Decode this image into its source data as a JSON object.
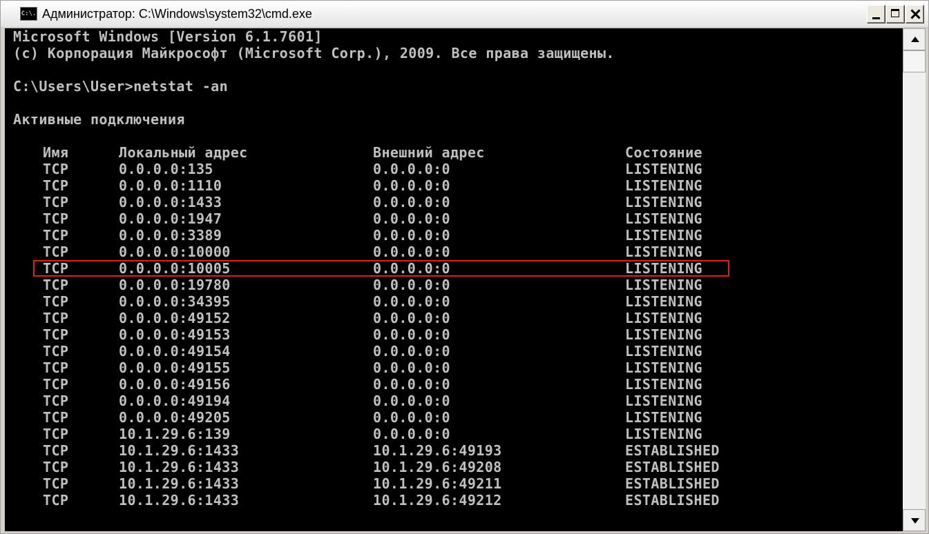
{
  "window": {
    "title": "Администратор: C:\\Windows\\system32\\cmd.exe",
    "icon": "cmd-icon",
    "icon_text": "C:\\."
  },
  "console": {
    "header_lines": [
      "Microsoft Windows [Version 6.1.7601]",
      "(c) Корпорация Майкрософт (Microsoft Corp.), 2009. Все права защищены.",
      "",
      "C:\\Users\\User>netstat -an",
      "",
      "Активные подключения",
      ""
    ],
    "table": {
      "columns": [
        "Имя",
        "Локальный адрес",
        "Внешний адрес",
        "Состояние"
      ],
      "rows": [
        [
          "TCP",
          "0.0.0.0:135",
          "0.0.0.0:0",
          "LISTENING"
        ],
        [
          "TCP",
          "0.0.0.0:1110",
          "0.0.0.0:0",
          "LISTENING"
        ],
        [
          "TCP",
          "0.0.0.0:1433",
          "0.0.0.0:0",
          "LISTENING"
        ],
        [
          "TCP",
          "0.0.0.0:1947",
          "0.0.0.0:0",
          "LISTENING"
        ],
        [
          "TCP",
          "0.0.0.0:3389",
          "0.0.0.0:0",
          "LISTENING"
        ],
        [
          "TCP",
          "0.0.0.0:10000",
          "0.0.0.0:0",
          "LISTENING"
        ],
        [
          "TCP",
          "0.0.0.0:10005",
          "0.0.0.0:0",
          "LISTENING"
        ],
        [
          "TCP",
          "0.0.0.0:19780",
          "0.0.0.0:0",
          "LISTENING"
        ],
        [
          "TCP",
          "0.0.0.0:34395",
          "0.0.0.0:0",
          "LISTENING"
        ],
        [
          "TCP",
          "0.0.0.0:49152",
          "0.0.0.0:0",
          "LISTENING"
        ],
        [
          "TCP",
          "0.0.0.0:49153",
          "0.0.0.0:0",
          "LISTENING"
        ],
        [
          "TCP",
          "0.0.0.0:49154",
          "0.0.0.0:0",
          "LISTENING"
        ],
        [
          "TCP",
          "0.0.0.0:49155",
          "0.0.0.0:0",
          "LISTENING"
        ],
        [
          "TCP",
          "0.0.0.0:49156",
          "0.0.0.0:0",
          "LISTENING"
        ],
        [
          "TCP",
          "0.0.0.0:49194",
          "0.0.0.0:0",
          "LISTENING"
        ],
        [
          "TCP",
          "0.0.0.0:49205",
          "0.0.0.0:0",
          "LISTENING"
        ],
        [
          "TCP",
          "10.1.29.6:139",
          "0.0.0.0:0",
          "LISTENING"
        ],
        [
          "TCP",
          "10.1.29.6:1433",
          "10.1.29.6:49193",
          "ESTABLISHED"
        ],
        [
          "TCP",
          "10.1.29.6:1433",
          "10.1.29.6:49208",
          "ESTABLISHED"
        ],
        [
          "TCP",
          "10.1.29.6:1433",
          "10.1.29.6:49211",
          "ESTABLISHED"
        ],
        [
          "TCP",
          "10.1.29.6:1433",
          "10.1.29.6:49212",
          "ESTABLISHED"
        ]
      ],
      "highlighted_row": 6
    },
    "highlight_color": "#e0201c",
    "text_color": "#c0c0c0",
    "background_color": "#000000"
  }
}
